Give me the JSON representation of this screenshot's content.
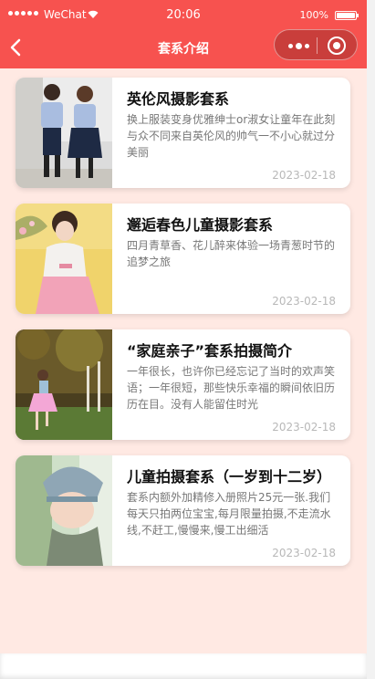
{
  "status_bar": {
    "carrier": "WeChat",
    "time": "20:06",
    "battery": "100%"
  },
  "nav": {
    "title": "套系介绍"
  },
  "articles": [
    {
      "title": "英伦风摄影套系",
      "desc": "换上服装变身优雅绅士or淑女让童年在此刻与众不同来自英伦风的帅气一不小心就过分美丽",
      "date": "2023-02-18"
    },
    {
      "title": "邂逅春色儿童摄影套系",
      "desc": "四月青草香、花儿醉来体验一场青葱时节的追梦之旅",
      "date": "2023-02-18"
    },
    {
      "title": "“家庭亲子”套系拍摄简介",
      "desc": "一年很长，也许你已经忘记了当时的欢声笑语；一年很短，那些快乐幸福的瞬间依旧历历在目。没有人能留住时光",
      "date": "2023-02-18"
    },
    {
      "title": "儿童拍摄套系（一岁到十二岁）",
      "desc": "套系内额外加精修入册照片25元一张.我们每天只拍两位宝宝,每月限量拍摄,不走流水线,不赶工,慢慢来,慢工出细活",
      "date": "2023-02-18"
    }
  ],
  "colors": {
    "accent": "#f7524f",
    "background": "#ffe9e3"
  },
  "icons": [
    "back-arrow-icon",
    "more-icon",
    "close-target-icon",
    "wifi-icon",
    "battery-icon"
  ]
}
